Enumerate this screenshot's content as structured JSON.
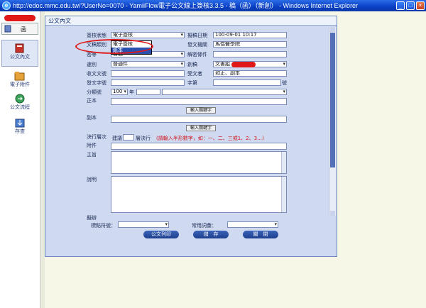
{
  "window": {
    "title": "http://edoc.mmc.edu.tw/?UserNo=0070 - YamiiFlow電子公文線上簽核3.3.5 - 稿（函）（新創） - Windows Internet Explorer",
    "ie_glyph": "e"
  },
  "sidebar": {
    "top_label": "函",
    "items": [
      {
        "label": "公文內文"
      },
      {
        "label": "電子附件"
      },
      {
        "label": "公文流程"
      },
      {
        "label": "存查"
      }
    ]
  },
  "tab": {
    "label": "公文內文"
  },
  "form": {
    "sign_status_label": "簽核狀態",
    "sign_status_value": "電子簽核",
    "draft_date_label": "擬稿日期",
    "draft_date_value": "100-09-01 10:17",
    "doc_class_label": "文稿類別",
    "doc_class_options": [
      "電子簽核",
      "紙本"
    ],
    "issuer_label": "發文機關",
    "issuer_value": "馬偕醫學院",
    "security_label": "密等",
    "security_value": "普通",
    "declass_label": "解密條件",
    "speed_label": "速別",
    "speed_value": "普通件",
    "signer_label": "創稿",
    "signer_value": "文書組",
    "recv_no_label": "收文文號",
    "recipient_label": "受文者",
    "recipient_value": "如正、副本",
    "send_no_label": "發文字號",
    "word_label": "字第",
    "hao_label": "號",
    "classify_label": "分類號",
    "year_value": "100",
    "year_label": "年",
    "main_copy_label": "正本",
    "cc_label": "副本",
    "input_keyword_btn": "輸入關鍵字",
    "resolve_label": "決行層次",
    "resolve_prefix": "建議",
    "resolve_suffix": "層決行",
    "resolve_hint": "(請輸入半形數字，如：一、二、三或1、2、3…)",
    "attach_label": "附件",
    "subject_label": "主旨",
    "desc_label": "說明",
    "bottom_cut_label": "擬辦"
  },
  "bottom": {
    "mark_label": "標點符號：",
    "common_label": "常用詞彙：",
    "print_btn": "公文列印",
    "save_btn": "儲　存",
    "close_btn": "關　閉"
  }
}
